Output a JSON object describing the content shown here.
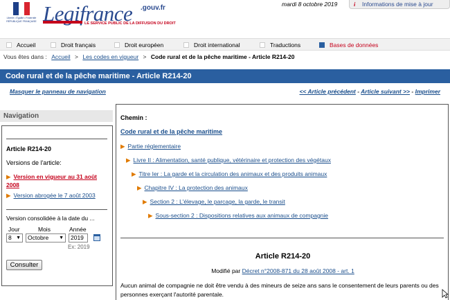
{
  "header": {
    "logo_motto": "Liberté • Égalité • Fraternité",
    "logo_country": "RÉPUBLIQUE FRANÇAISE",
    "logo_name": "Legifrance",
    "logo_domain": ".gouv.fr",
    "logo_tagline": "LE SERVICE PUBLIC DE LA DIFFUSION DU DROIT",
    "date": "mardi 8 octobre 2019",
    "info_label": "Informations de mise à jour"
  },
  "menu": {
    "items": [
      {
        "label": "Accueil"
      },
      {
        "label": "Droit français"
      },
      {
        "label": "Droit européen"
      },
      {
        "label": "Droit international"
      },
      {
        "label": "Traductions"
      },
      {
        "label": "Bases de données"
      }
    ],
    "active_color": "#c5001b"
  },
  "breadcrumb": {
    "prefix": "Vous êtes dans :",
    "items": [
      "Accueil",
      "Les codes en vigueur",
      "Code rural et de la pêche maritime - Article R214-20"
    ],
    "sep": ">"
  },
  "title": "Code rural et de la pêche maritime - Article R214-20",
  "links": {
    "hide_nav": "Masquer le panneau de navigation",
    "prev": "<< Article précédent",
    "dash": "-",
    "next": "Article suivant >>",
    "print": "Imprimer"
  },
  "nav": {
    "heading": "Navigation",
    "article": "Article R214-20",
    "versions_label": "Versions de l'article:",
    "current_version": "Version en vigueur au 31 août 2008",
    "old_version": "Version abrogée le 7 août 2003",
    "consolidated_label": "Version consolidée à la date du ...",
    "day_label": "Jour",
    "month_label": "Mois",
    "year_label": "Année",
    "day_value": "8",
    "month_value": "Octobre",
    "year_value": "2019",
    "example": "Ex: 2019",
    "consult_button": "Consulter"
  },
  "main": {
    "chemin_label": "Chemin :",
    "code": "Code rural et de la pêche maritime",
    "tree": [
      "Partie réglementaire",
      "Livre II : Alimentation, santé publique, vétérinaire et protection des végétaux",
      "Titre Ier : La garde et la circulation des animaux et des produits animaux",
      "Chapitre IV : La protection des animaux",
      "Section 2 : L'élevage, le parcage, la garde, le transit",
      "Sous-section 2 : Dispositions relatives aux animaux de compagnie"
    ],
    "article_title": "Article R214-20",
    "modified_prefix": "Modifié par",
    "modified_link": "Décret n°2008-871 du 28 août 2008 - art. 1",
    "text": "Aucun animal de compagnie ne doit être vendu à des mineurs de seize ans sans le consentement de leurs parents ou des personnes exerçant l'autorité parentale."
  }
}
